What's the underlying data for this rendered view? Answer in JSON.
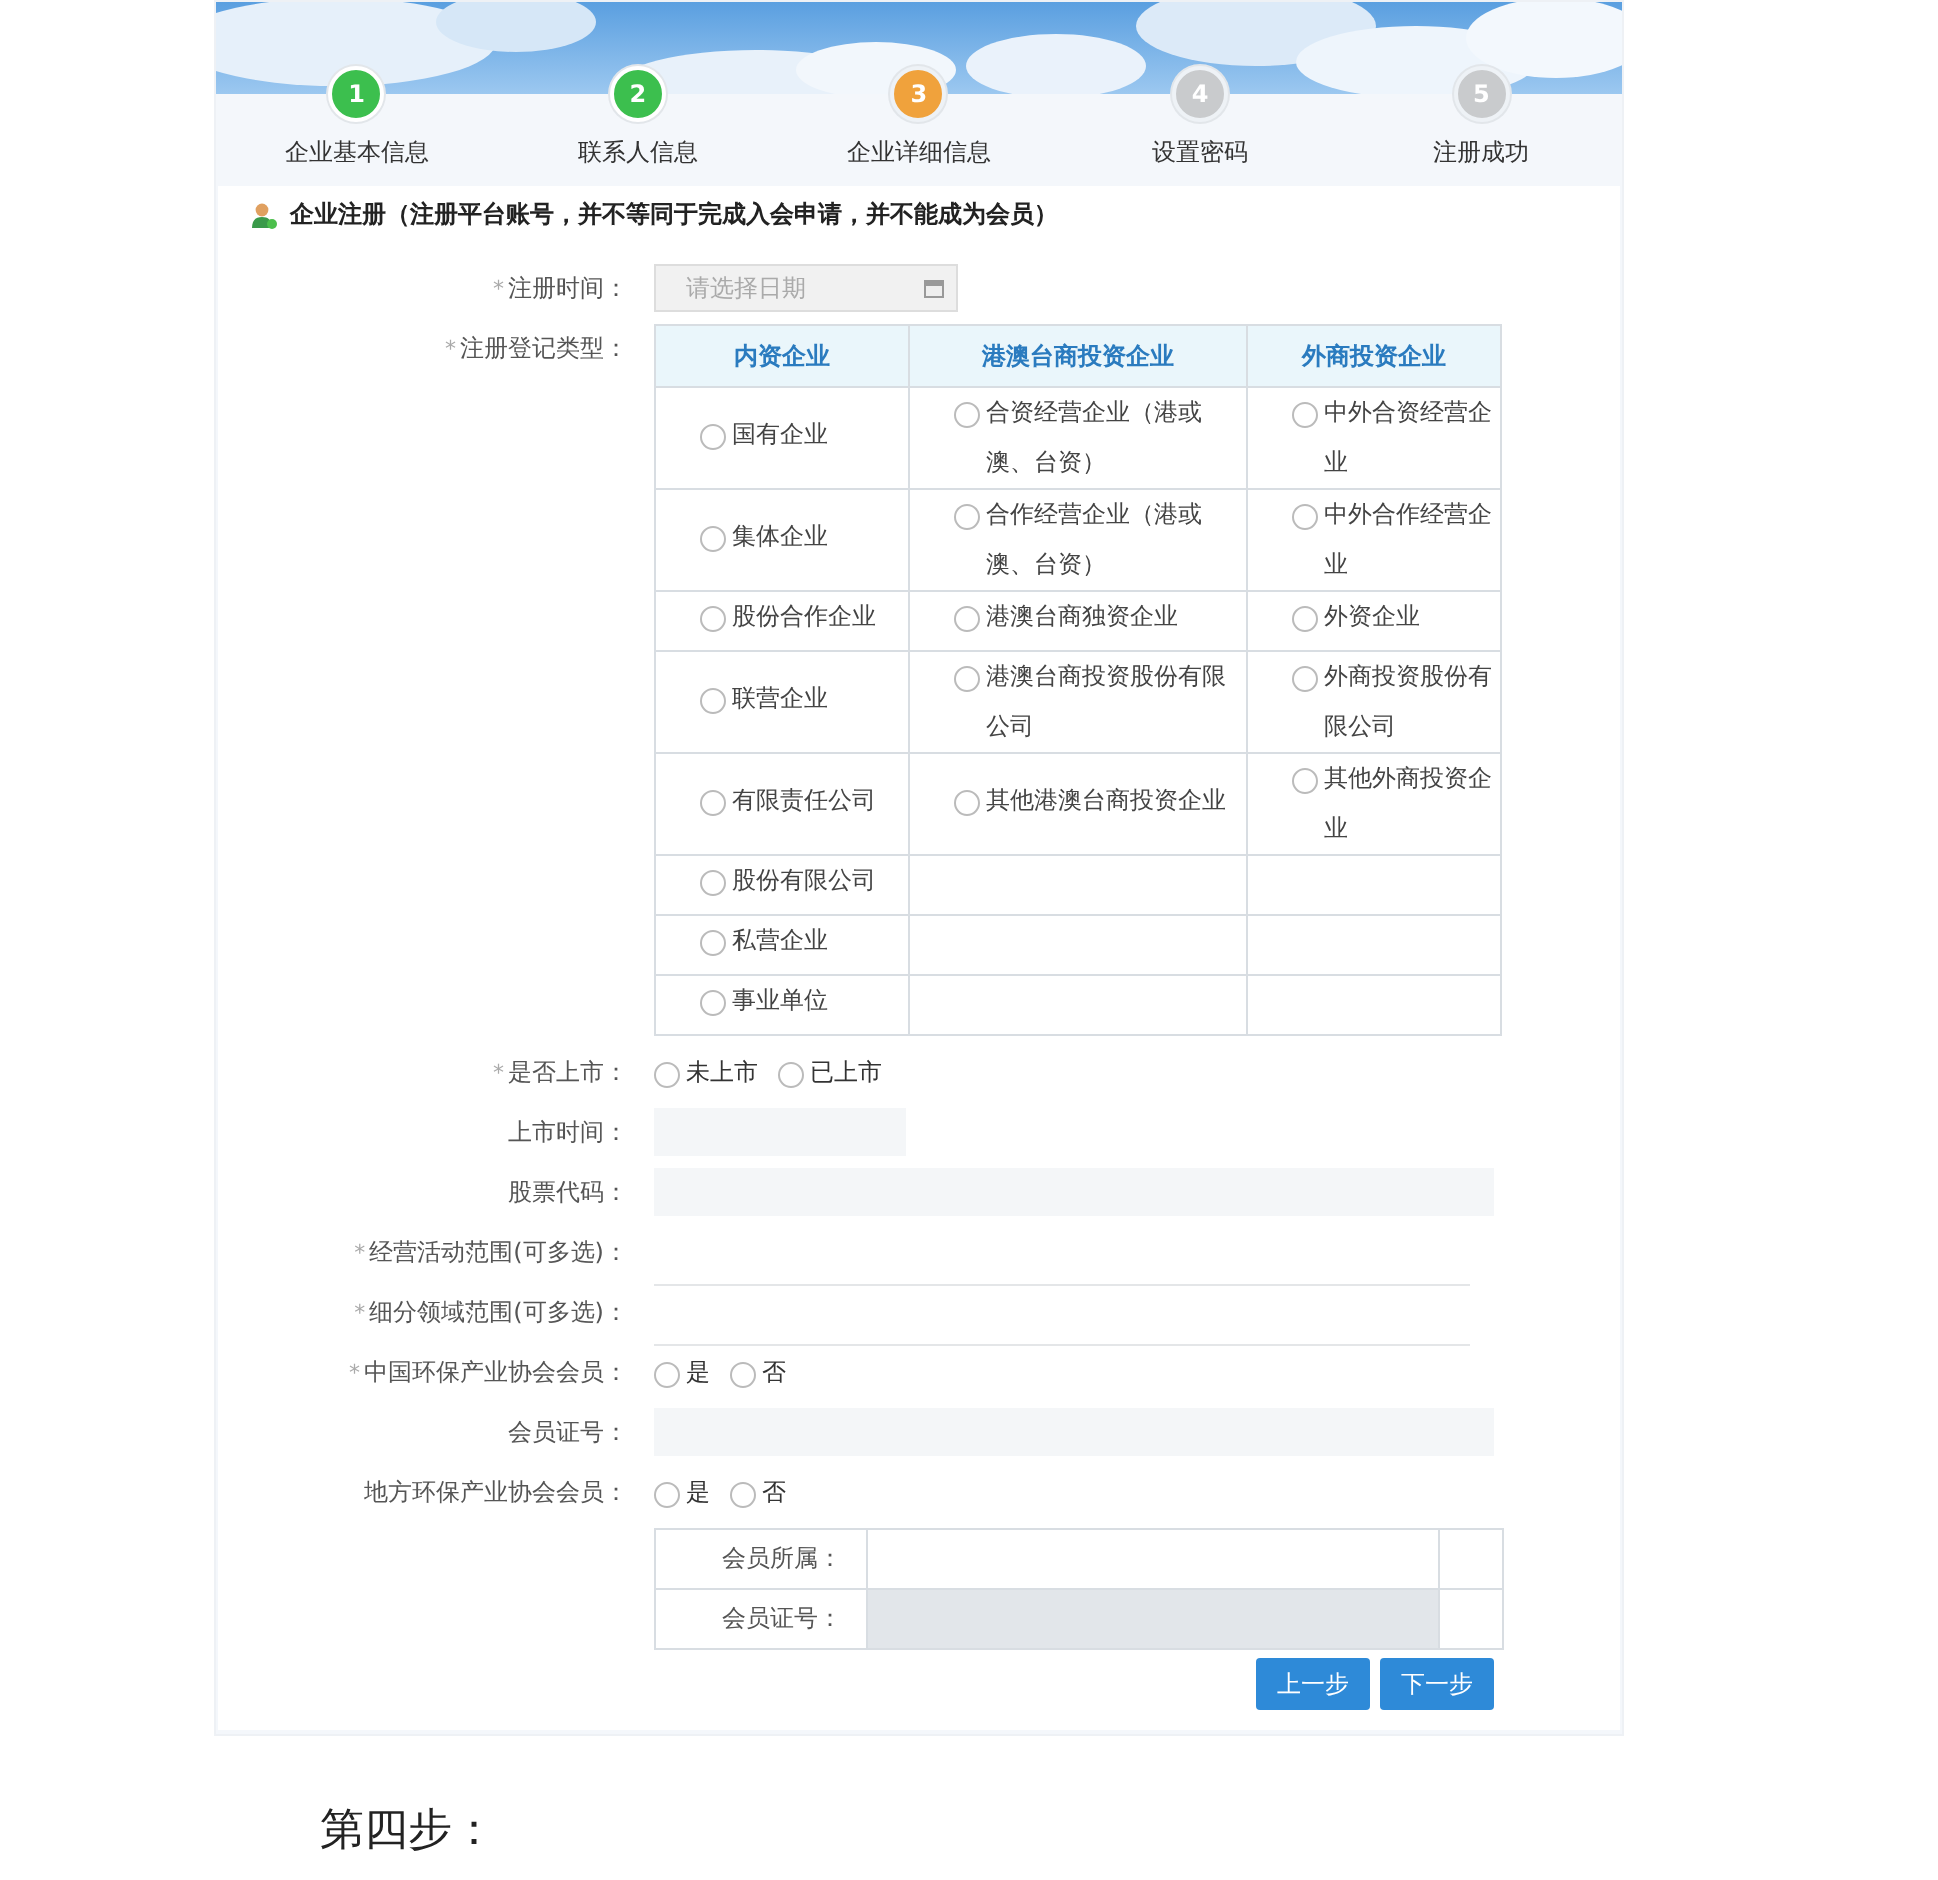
{
  "steps": [
    {
      "number": "1",
      "label": "企业基本信息",
      "done": true,
      "current": false
    },
    {
      "number": "2",
      "label": "联系人信息",
      "done": true,
      "current": false
    },
    {
      "number": "3",
      "label": "企业详细信息",
      "done": false,
      "current": true
    },
    {
      "number": "4",
      "label": "设置密码",
      "done": false,
      "current": false
    },
    {
      "number": "5",
      "label": "注册成功",
      "done": false,
      "current": false
    }
  ],
  "section_title": "企业注册（注册平台账号，并不等同于完成入会申请，并不能成为会员）",
  "fields": [
    {
      "kind": "date",
      "required": "*",
      "label": "注册时间：",
      "placeholder": "请选择日期"
    },
    {
      "kind": "options_table",
      "required": "*",
      "label": "注册登记类型：",
      "columns": [
        "内资企业",
        "港澳台商投资企业",
        "外商投资企业"
      ],
      "rows": [
        [
          {
            "label": "国有企业",
            "selected": false
          },
          {
            "label": "合资经营企业（港或澳、台资）",
            "selected": false
          },
          {
            "label": "中外合资经营企业",
            "selected": false
          }
        ],
        [
          {
            "label": "集体企业",
            "selected": false
          },
          {
            "label": "合作经营企业（港或澳、台资）",
            "selected": false
          },
          {
            "label": "中外合作经营企业",
            "selected": false
          }
        ],
        [
          {
            "label": "股份合作企业",
            "selected": false
          },
          {
            "label": "港澳台商独资企业",
            "selected": false
          },
          {
            "label": "外资企业",
            "selected": false
          }
        ],
        [
          {
            "label": "联营企业",
            "selected": false
          },
          {
            "label": "港澳台商投资股份有限公司",
            "selected": false
          },
          {
            "label": "外商投资股份有限公司",
            "selected": false
          }
        ],
        [
          {
            "label": "有限责任公司",
            "selected": false
          },
          {
            "label": "其他港澳台商投资企业",
            "selected": false
          },
          {
            "label": "其他外商投资企业",
            "selected": false
          }
        ],
        [
          {
            "label": "股份有限公司",
            "selected": false
          },
          null,
          null
        ],
        [
          {
            "label": "私营企业",
            "selected": false
          },
          null,
          null
        ],
        [
          {
            "label": "事业单位",
            "selected": false
          },
          null,
          null
        ]
      ]
    },
    {
      "kind": "radios",
      "required": "*",
      "label": "是否上市：",
      "options": [
        {
          "label": "未上市",
          "selected": false
        },
        {
          "label": "已上市",
          "selected": false
        }
      ]
    },
    {
      "kind": "short_field",
      "label": "上市时间：",
      "disabled": true
    },
    {
      "kind": "field",
      "label": "股票代码：",
      "disabled": true
    },
    {
      "kind": "select_area",
      "required": "*",
      "label": "经营活动范围(可多选)："
    },
    {
      "kind": "select_area",
      "required": "*",
      "label": "细分领域范围(可多选)："
    },
    {
      "kind": "radios",
      "required": "*",
      "label": "中国环保产业协会会员：",
      "options": [
        {
          "label": "是",
          "selected": false
        },
        {
          "label": "否",
          "selected": false
        }
      ]
    },
    {
      "kind": "field",
      "label": "会员证号：",
      "disabled": true
    },
    {
      "kind": "radios",
      "label": "地方环保产业协会会员：",
      "options": [
        {
          "label": "是",
          "selected": false
        },
        {
          "label": "否",
          "selected": false
        }
      ]
    },
    {
      "kind": "subtable",
      "rows": [
        {
          "label": "会员所属：",
          "disabled": false
        },
        {
          "label": "会员证号：",
          "disabled": true
        }
      ]
    }
  ],
  "buttons": [
    "上一步",
    "下一步"
  ],
  "caption": "第四步："
}
